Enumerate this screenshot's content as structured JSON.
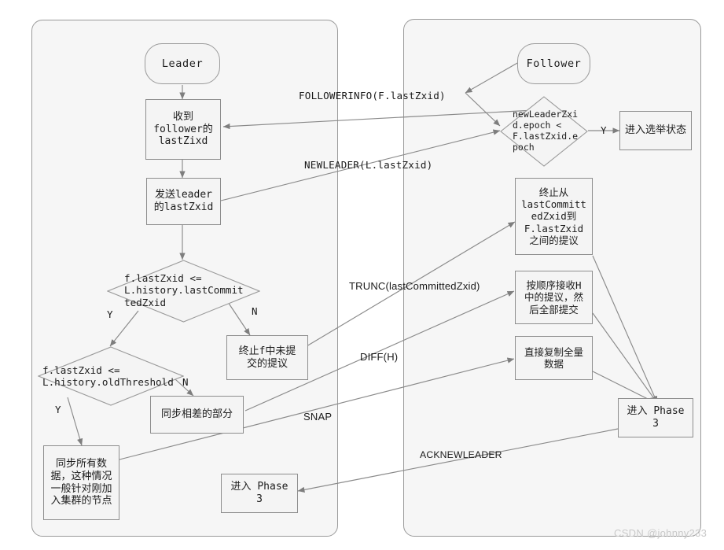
{
  "meta": {
    "watermark": "CSDN @johnny233"
  },
  "lanes": [
    {
      "id": "leader-lane",
      "label": "Leader"
    },
    {
      "id": "follower-lane",
      "label": "Follower"
    }
  ],
  "terminators": {
    "leader": "Leader",
    "follower": "Follower"
  },
  "leader_nodes": {
    "recv_follower_info": "收到\nfollower的\nlastZixd",
    "send_leader_zxid": "发送leader\n的lastZxid",
    "abort_uncommitted": "终止f中未提\n交的提议",
    "sync_diff": "同步相差的部分",
    "sync_all": "同步所有数\n据，这种情况\n一般针对刚加\n入集群的节点",
    "enter_phase3": "进入 Phase\n3"
  },
  "leader_decisions": {
    "d1": "f.lastZxid <=\nL.history.lastCommit\ntedZxid",
    "d2": "f.lastZxid <=\nL.history.oldThreshold"
  },
  "follower_nodes": {
    "enter_election": "进入选举状态",
    "abort_range": "终止从\nlastCommitt\nedZxid到\nF.lastZxid\n之间的提议",
    "recv_h_commit": "按顺序接收H\n中的提议，然\n后全部提交",
    "copy_all": "直接复制全量\n数据",
    "enter_phase3": "进入 Phase\n3"
  },
  "follower_decisions": {
    "d1": "newLeaderZxi\nd.epoch <\nF.lastZxid.e\npoch"
  },
  "branch_labels": {
    "leader_d1_yes": "Y",
    "leader_d1_no": "N",
    "leader_d2_yes": "Y",
    "leader_d2_no": "N",
    "follower_d1_yes": "Y"
  },
  "edge_labels": {
    "followerinfo": "FOLLOWERINFO(F.lastZxid)",
    "newleader": "NEWLEADER(L.lastZxid)",
    "trunc": "TRUNC(lastCommittedZxid)",
    "diff": "DIFF(H)",
    "snap": "SNAP",
    "acknewleader": "ACKNEWLEADER"
  },
  "colors": {
    "node_fill": "#f4f4f4",
    "node_stroke": "#8d8d8d",
    "lane_fill": "#f6f6f6",
    "lane_stroke": "#9a9a9a",
    "wire": "#8a8a8a",
    "text": "#1c1c1c",
    "watermark": "#c9c9c9"
  }
}
